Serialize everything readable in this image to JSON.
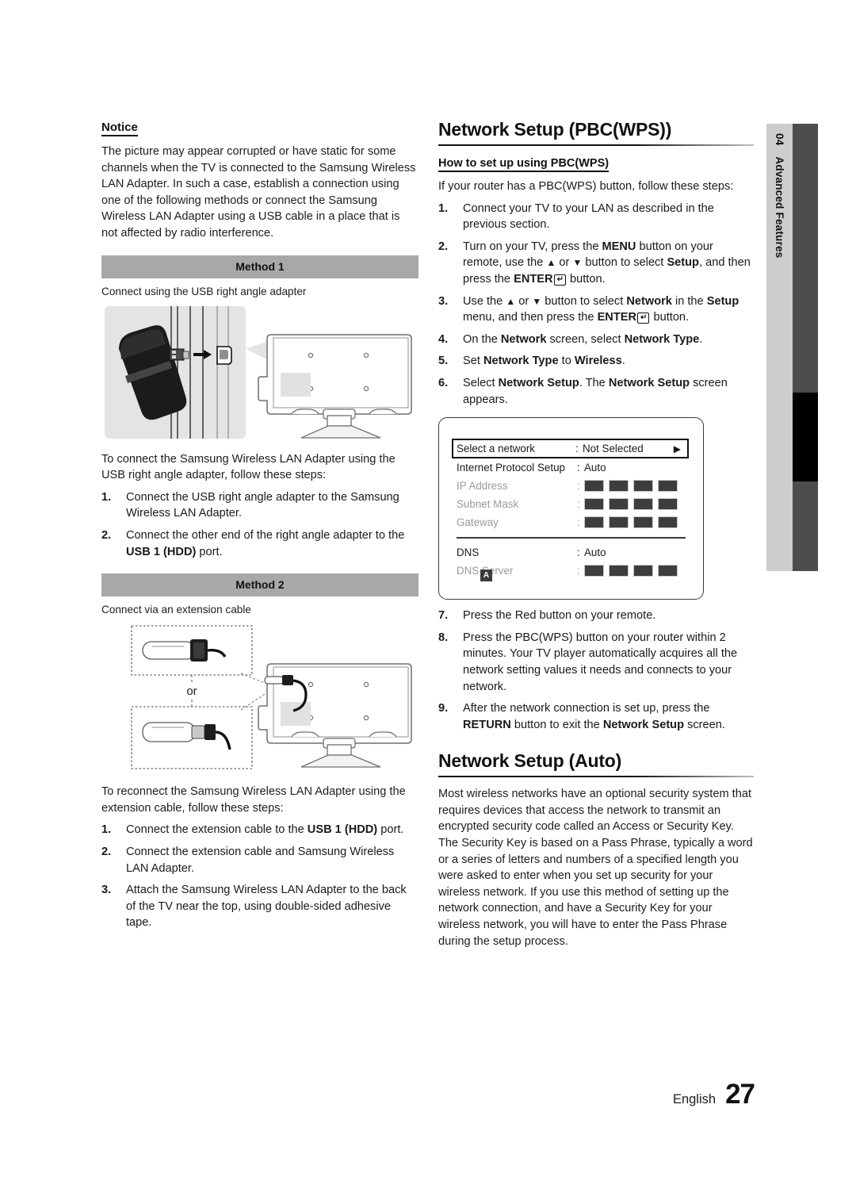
{
  "chapter_tab": {
    "number": "04",
    "title": "Advanced Features"
  },
  "left_column": {
    "notice_title": "Notice",
    "notice_body": "The picture may appear corrupted or have static for some channels when the TV is connected to the Samsung Wireless LAN Adapter. In such a case, establish a connection using one of the following methods or connect the Samsung Wireless LAN Adapter using a USB cable in a place that is not affected by radio interference.",
    "method1": {
      "banner": "Method 1",
      "caption": "Connect using the USB right angle adapter",
      "intro": "To connect the Samsung Wireless LAN Adapter using the USB right angle adapter, follow these steps:",
      "steps": [
        {
          "num": "1.",
          "text_pre": "Connect the USB right angle adapter to the Samsung Wireless LAN Adapter.",
          "bold": "",
          "text_post": ""
        },
        {
          "num": "2.",
          "text_pre": "Connect the other end of the right angle adapter to the ",
          "bold": "USB 1 (HDD)",
          "text_post": " port."
        }
      ]
    },
    "method2": {
      "banner": "Method 2",
      "caption": "Connect via an extension cable",
      "or_label": "or",
      "intro": "To reconnect the Samsung Wireless LAN Adapter using the extension cable, follow these steps:",
      "steps": [
        {
          "num": "1.",
          "text_pre": "Connect the extension cable to the ",
          "bold": "USB 1 (HDD)",
          "text_post": " port."
        },
        {
          "num": "2.",
          "text_pre": "Connect the extension cable and Samsung Wireless LAN Adapter.",
          "bold": "",
          "text_post": ""
        },
        {
          "num": "3.",
          "text_pre": "Attach the Samsung Wireless LAN Adapter to the back of the TV near the top, using double-sided adhesive tape.",
          "bold": "",
          "text_post": ""
        }
      ]
    }
  },
  "right_column": {
    "section1_title": "Network Setup (PBC(WPS))",
    "subsection_title": "How to set up using PBC(WPS)",
    "intro": "If your router has a PBC(WPS) button, follow these steps:",
    "steps": [
      {
        "num": "1.",
        "text": "Connect your TV to your LAN as described in the previous section."
      },
      {
        "num": "2.",
        "text": "Turn on your TV, press the MENU button on your remote, use the ▲ or ▼ button to select Setup, and then press the ENTER button."
      },
      {
        "num": "3.",
        "text": "Use the ▲ or ▼ button to select Network in the Setup menu, and then press the ENTER button."
      },
      {
        "num": "4.",
        "text": "On the Network screen, select Network Type."
      },
      {
        "num": "5.",
        "text": "Set Network Type to Wireless."
      },
      {
        "num": "6.",
        "text": "Select Network Setup. The Network Setup screen appears."
      },
      {
        "num": "7.",
        "text": "Press the Red button on your remote."
      },
      {
        "num": "8.",
        "text": "Press the PBC(WPS) button on your router within 2 minutes. Your TV player automatically acquires all the network setting values it needs and connects to your network."
      },
      {
        "num": "9.",
        "text": "After the network connection is set up, press the RETURN button to exit the Network Setup screen."
      }
    ],
    "setup_screen": {
      "rows": [
        {
          "label": "Select a network",
          "value": "Not Selected",
          "type": "selected",
          "caret": "▶"
        },
        {
          "label": "Internet Protocol Setup",
          "value": "Auto",
          "type": "normal"
        },
        {
          "label": "IP Address",
          "value": "",
          "type": "boxes"
        },
        {
          "label": "Subnet Mask",
          "value": "",
          "type": "boxes"
        },
        {
          "label": "Gateway",
          "value": "",
          "type": "boxes"
        },
        {
          "label": "DNS",
          "value": "Auto",
          "type": "normal"
        },
        {
          "label": "DNS Server",
          "value": "",
          "type": "boxes"
        }
      ],
      "badge": "A",
      "colon": ":"
    },
    "section2_title": "Network Setup (Auto)",
    "section2_body": "Most wireless networks have an optional security system that requires devices that access the network to transmit an encrypted security code called an Access or Security Key. The Security Key is based on a Pass Phrase, typically a word or a series of letters and numbers of a specified length you were asked to enter when you set up security for your wireless network. If you use this method of setting up the network connection, and have a Security Key for your wireless network, you will have to enter the Pass Phrase during the setup process."
  },
  "footer": {
    "language": "English",
    "page_number": "27"
  },
  "colors": {
    "banner_gray": "#a8a8a8",
    "tab_light": "#cdcdcd",
    "tab_dark": "#4d4d4d",
    "tab_marker": "#000000",
    "box_dark": "#3d3d3d"
  }
}
